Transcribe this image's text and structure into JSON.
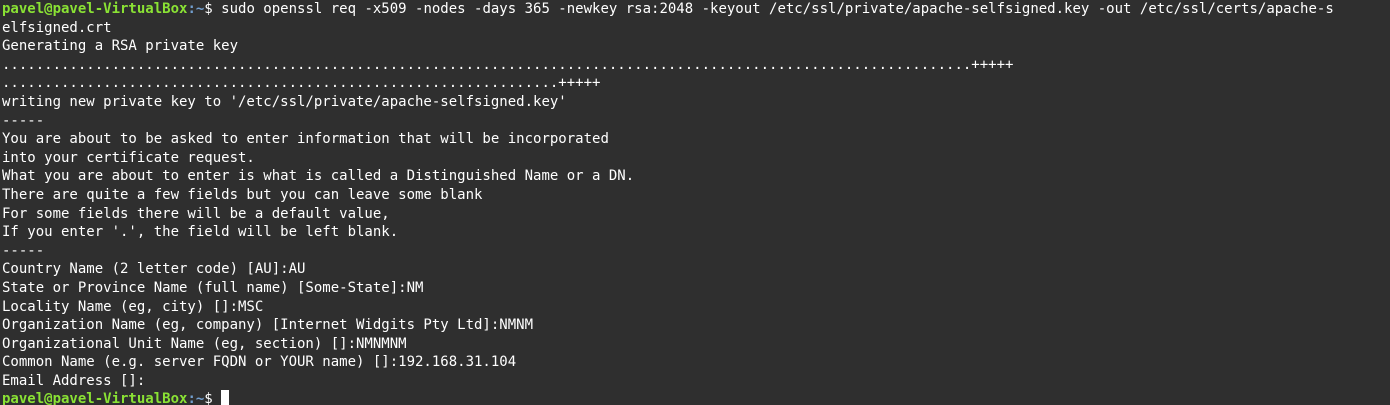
{
  "prompt": {
    "user_host": "pavel@pavel-VirtualBox",
    "path": ":~",
    "symbol": "$ "
  },
  "command_line1": "sudo openssl req -x509 -nodes -days 365 -newkey rsa:2048 -keyout /etc/ssl/private/apache-selfsigned.key -out /etc/ssl/certs/apache-s",
  "command_line2": "elfsigned.crt",
  "output": [
    "Generating a RSA private key",
    "...................................................................................................................+++++",
    "..................................................................+++++",
    "writing new private key to '/etc/ssl/private/apache-selfsigned.key'",
    "-----",
    "You are about to be asked to enter information that will be incorporated",
    "into your certificate request.",
    "What you are about to enter is what is called a Distinguished Name or a DN.",
    "There are quite a few fields but you can leave some blank",
    "For some fields there will be a default value,",
    "If you enter '.', the field will be left blank.",
    "-----",
    "Country Name (2 letter code) [AU]:AU",
    "State or Province Name (full name) [Some-State]:NM",
    "Locality Name (eg, city) []:MSC",
    "Organization Name (eg, company) [Internet Widgits Pty Ltd]:NMNM",
    "Organizational Unit Name (eg, section) []:NMNMNM",
    "Common Name (e.g. server FQDN or YOUR name) []:192.168.31.104",
    "Email Address []:"
  ],
  "colors": {
    "background": "#2f2f2f",
    "text": "#ffffff",
    "prompt_user": "#8ae234",
    "prompt_path": "#729fcf"
  }
}
